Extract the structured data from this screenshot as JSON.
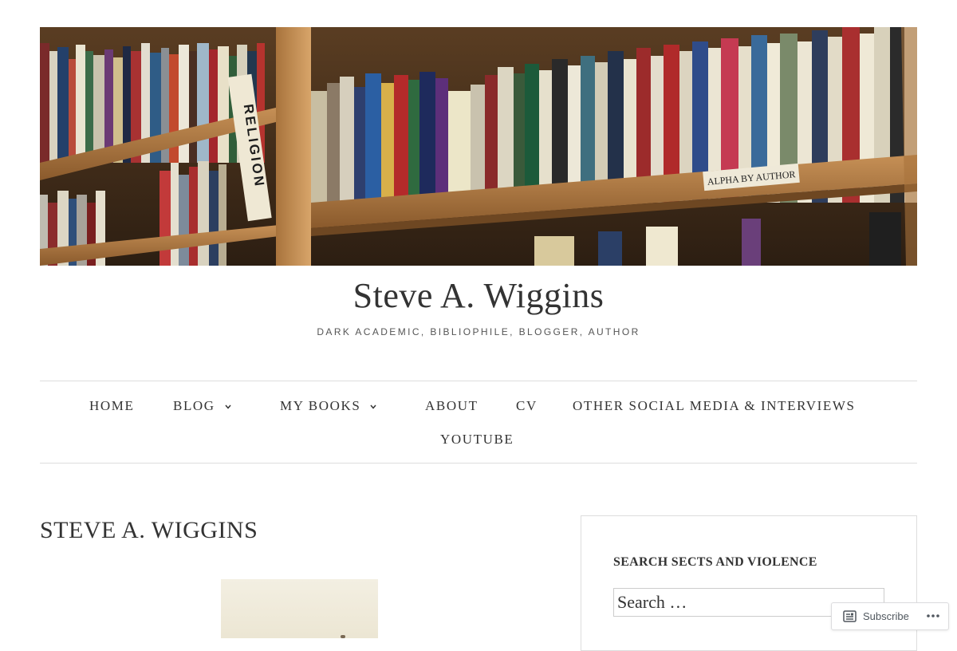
{
  "site": {
    "title": "Steve A. Wiggins",
    "tagline": "DARK ACADEMIC, BIBLIOPHILE, BLOGGER, AUTHOR"
  },
  "header_image": {
    "sign_label": "RELIGION",
    "shelf_label": "ALPHA BY AUTHOR"
  },
  "nav": {
    "items": [
      {
        "label": "HOME",
        "has_submenu": false
      },
      {
        "label": "BLOG",
        "has_submenu": true
      },
      {
        "label": "MY BOOKS",
        "has_submenu": true
      },
      {
        "label": "ABOUT",
        "has_submenu": false
      },
      {
        "label": "CV",
        "has_submenu": false
      },
      {
        "label": "OTHER SOCIAL MEDIA & INTERVIEWS",
        "has_submenu": false
      },
      {
        "label": "YOUTUBE",
        "has_submenu": false
      }
    ]
  },
  "main": {
    "page_title": "STEVE A. WIGGINS"
  },
  "sidebar": {
    "search_widget": {
      "title": "SEARCH SECTS AND VIOLENCE",
      "placeholder": "Search …"
    }
  },
  "subscribe_bar": {
    "subscribe_label": "Subscribe",
    "more_label": "•••"
  },
  "icons": {
    "submenu": "chevron-down-icon",
    "subscribe": "reader-icon",
    "more": "ellipsis-icon"
  }
}
